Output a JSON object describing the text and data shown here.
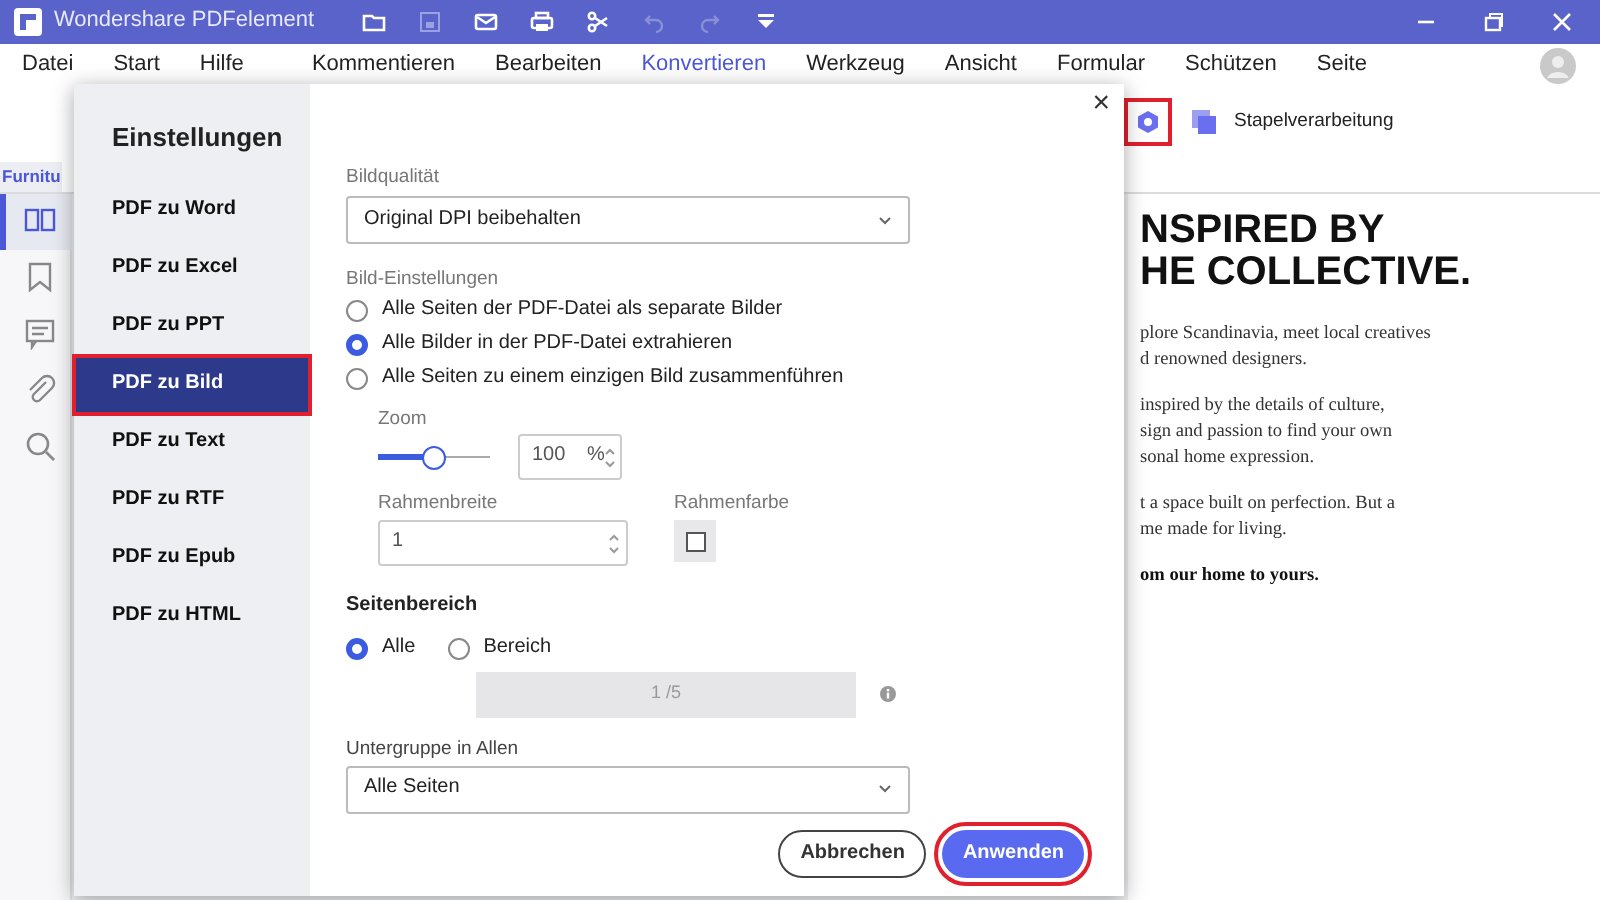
{
  "window": {
    "title": "Wondershare PDFelement"
  },
  "menu": [
    {
      "label": "Datei",
      "selected": false
    },
    {
      "label": "Start",
      "selected": false
    },
    {
      "label": "Hilfe",
      "selected": false
    },
    {
      "label": "Kommentieren",
      "selected": false
    },
    {
      "label": "Bearbeiten",
      "selected": false
    },
    {
      "label": "Konvertieren",
      "selected": true
    },
    {
      "label": "Werkzeug",
      "selected": false
    },
    {
      "label": "Ansicht",
      "selected": false
    },
    {
      "label": "Formular",
      "selected": false
    },
    {
      "label": "Schützen",
      "selected": false
    },
    {
      "label": "Seite",
      "selected": false
    }
  ],
  "toolbar": {
    "settings": {
      "highlighted": true
    },
    "batch": {
      "label": "Stapelverarbeitung"
    }
  },
  "document_tab": {
    "label": "Furnitu"
  },
  "side_rail": [
    {
      "kind": "pages",
      "selected": true
    },
    {
      "kind": "bookmark",
      "selected": false
    },
    {
      "kind": "comment",
      "selected": false
    },
    {
      "kind": "attachment",
      "selected": false
    },
    {
      "kind": "search",
      "selected": false
    }
  ],
  "document": {
    "heading": [
      "NSPIRED BY",
      "HE COLLECTIVE."
    ],
    "paragraphs": [
      {
        "lines": [
          "plore Scandinavia, meet local creatives",
          "d renowned designers."
        ],
        "bold": false
      },
      {
        "lines": [
          "inspired by the details of culture,",
          "sign and passion to find your own",
          "sonal home expression."
        ],
        "bold": false
      },
      {
        "lines": [
          "t a space built on perfection. But a",
          "me made for living."
        ],
        "bold": false
      },
      {
        "lines": [
          "om our home to yours."
        ],
        "bold": true
      }
    ]
  },
  "dialog": {
    "close": "×",
    "nav_title": "Einstellungen",
    "nav": [
      {
        "label": "PDF zu Word",
        "selected": false,
        "highlighted": false
      },
      {
        "label": "PDF zu Excel",
        "selected": false,
        "highlighted": false
      },
      {
        "label": "PDF zu PPT",
        "selected": false,
        "highlighted": false
      },
      {
        "label": "PDF zu Bild",
        "selected": true,
        "highlighted": true
      },
      {
        "label": "PDF zu Text",
        "selected": false,
        "highlighted": false
      },
      {
        "label": "PDF zu RTF",
        "selected": false,
        "highlighted": false
      },
      {
        "label": "PDF zu Epub",
        "selected": false,
        "highlighted": false
      },
      {
        "label": "PDF zu HTML",
        "selected": false,
        "highlighted": false
      }
    ],
    "image_quality": {
      "label": "Bildqualität",
      "value": "Original DPI beibehalten"
    },
    "image_settings": {
      "label": "Bild-Einstellungen",
      "options": [
        {
          "label": "Alle Seiten der PDF-Datei als separate Bilder",
          "selected": false
        },
        {
          "label": "Alle Bilder in der PDF-Datei extrahieren",
          "selected": true
        },
        {
          "label": "Alle Seiten zu einem einzigen Bild zusammenführen",
          "selected": false
        }
      ]
    },
    "zoom": {
      "label": "Zoom",
      "level": 0.5,
      "value": "100",
      "unit": "%"
    },
    "border_width": {
      "label": "Rahmenbreite",
      "value": "1"
    },
    "border_color": {
      "label": "Rahmenfarbe",
      "checked": false
    },
    "page_range": {
      "title": "Seitenbereich",
      "options": [
        {
          "label": "Alle",
          "selected": true
        },
        {
          "label": "Bereich",
          "selected": false
        }
      ],
      "range_value": "1 /5",
      "disabled": true
    },
    "subset": {
      "label": "Untergruppe in Allen",
      "value": "Alle Seiten"
    },
    "buttons": [
      {
        "label": "Abbrechen",
        "kind": "secondary",
        "highlighted": false
      },
      {
        "label": "Anwenden",
        "kind": "primary",
        "highlighted": true
      }
    ]
  }
}
